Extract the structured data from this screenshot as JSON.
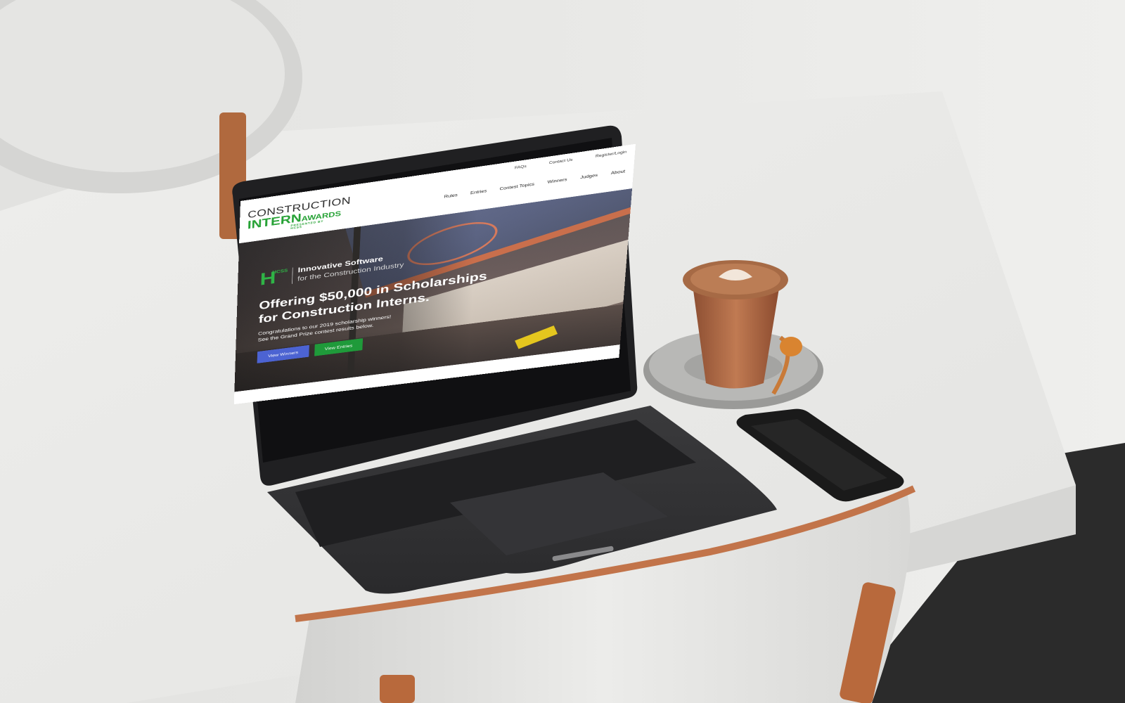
{
  "colors": {
    "accent_green": "#27a236",
    "button_blue": "#4c63d2",
    "button_green": "#1f9a3a"
  },
  "site": {
    "logo": {
      "line1": "CONSTRUCTION",
      "line2_main": "INTERN",
      "line2_suffix": "AWARDS",
      "presented_by": "PRESENTED BY HCSS"
    },
    "utility_nav": [
      "FAQs",
      "Contact Us",
      "Register/Login"
    ],
    "main_nav": [
      "Rules",
      "Entries",
      "Contest Topics",
      "Winners",
      "Judges",
      "About"
    ],
    "hero": {
      "badge_text": "HCSS",
      "tagline_1": "Innovative Software",
      "tagline_2": "for the Construction Industry",
      "headline_1": "Offering $50,000 in Scholarships",
      "headline_2": "for Construction Interns.",
      "body_1": "Congratulations to our 2019 scholarship winners!",
      "body_2": "See the Grand Prize contest results below.",
      "button_winners": "View Winners",
      "button_entries": "View Entries"
    }
  }
}
